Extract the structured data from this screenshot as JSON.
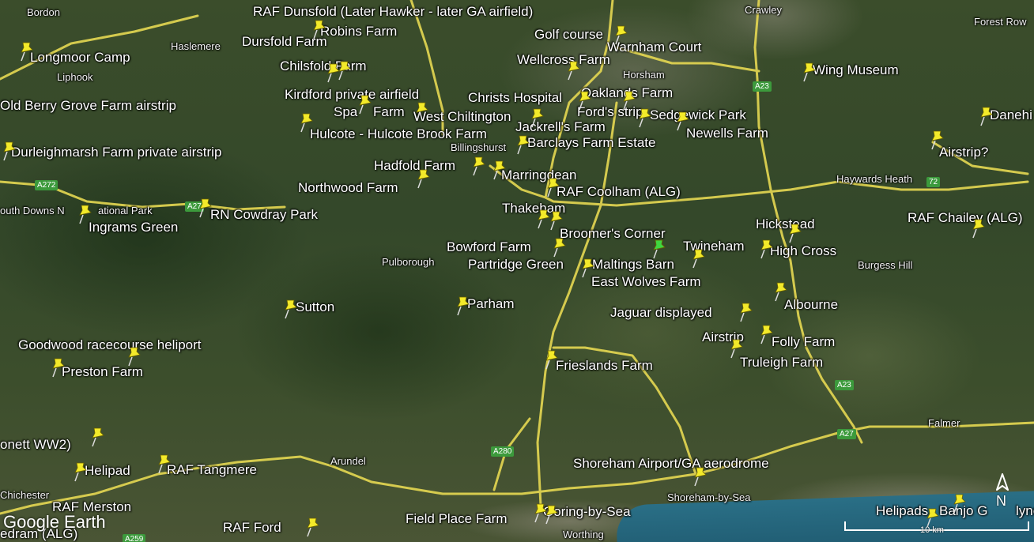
{
  "branding": {
    "logo_text": "Google Earth"
  },
  "scale": {
    "label": "10 km"
  },
  "compass": {
    "north_label": "N"
  },
  "colors": {
    "road": "#e6d852",
    "pin_yellow": "#f3ea2a",
    "pin_green": "#3fd63f",
    "sea": "#2a6f86"
  },
  "placemarks": [
    "RAF Dunsfold (Later Hawker - later GA airfield)",
    "Robins Farm",
    "Dursfold Farm",
    "Longmoor Camp",
    "Chilsfold Farm",
    "Golf course",
    "Warnham Court",
    "Wellcross Farm",
    "Wing Museum",
    "Old Berry Grove Farm airstrip",
    "Kirdford private airfield",
    "Christs Hospital",
    "Oaklands Farm",
    "Spa",
    "Farm",
    "West Chiltington",
    "Ford's strip",
    "Sedgewick Park",
    "Danehi",
    "Hulcote - Hulcote Brook Farm",
    "Jackrell's Farm",
    "Newells Farm",
    "Durleighmarsh Farm private airstrip",
    "Barclays Farm Estate",
    "Airstrip?",
    "Hadfold Farm",
    "Marringdean",
    "Northwood Farm",
    "RAF Coolham (ALG)",
    "Thakeham",
    "RN Cowdray Park",
    "Ingrams Green",
    "Broomer's Corner",
    "Hickstead",
    "RAF Chailey (ALG)",
    "Bowford Farm",
    "Twineham",
    "High Cross",
    "Partridge Green",
    "Maltings Barn",
    "East Wolves Farm",
    "Sutton",
    "Parham",
    "Albourne",
    "Jaguar displayed",
    "Airstrip",
    "Folly Farm",
    "Goodwood racecourse heliport",
    "Truleigh Farm",
    "Preston Farm",
    "Frieslands Farm",
    "onett WW2)",
    "Shoreham Airport/GA aerodrome",
    "Helipad",
    "RAF Tangmere",
    "RAF Merston",
    "Field Place Farm",
    "Goring-by-Sea",
    "Helipads",
    "Banjo G",
    "lyne",
    "RAF Ford",
    "edram (ALG)"
  ],
  "towns": [
    "Bordon",
    "Haslemere",
    "Crawley",
    "Forest Row",
    "Liphook",
    "Horsham",
    "Billingshurst",
    "Haywards Heath",
    "outh Downs N",
    "ational Park",
    "Pulborough",
    "Burgess Hill",
    "Falmer",
    "Arundel",
    "Chichester",
    "Shoreham-by-Sea",
    "Worthing"
  ],
  "road_labels": [
    "A272",
    "A27",
    "A23",
    "A23",
    "A27",
    "A280",
    "A259",
    "72"
  ]
}
